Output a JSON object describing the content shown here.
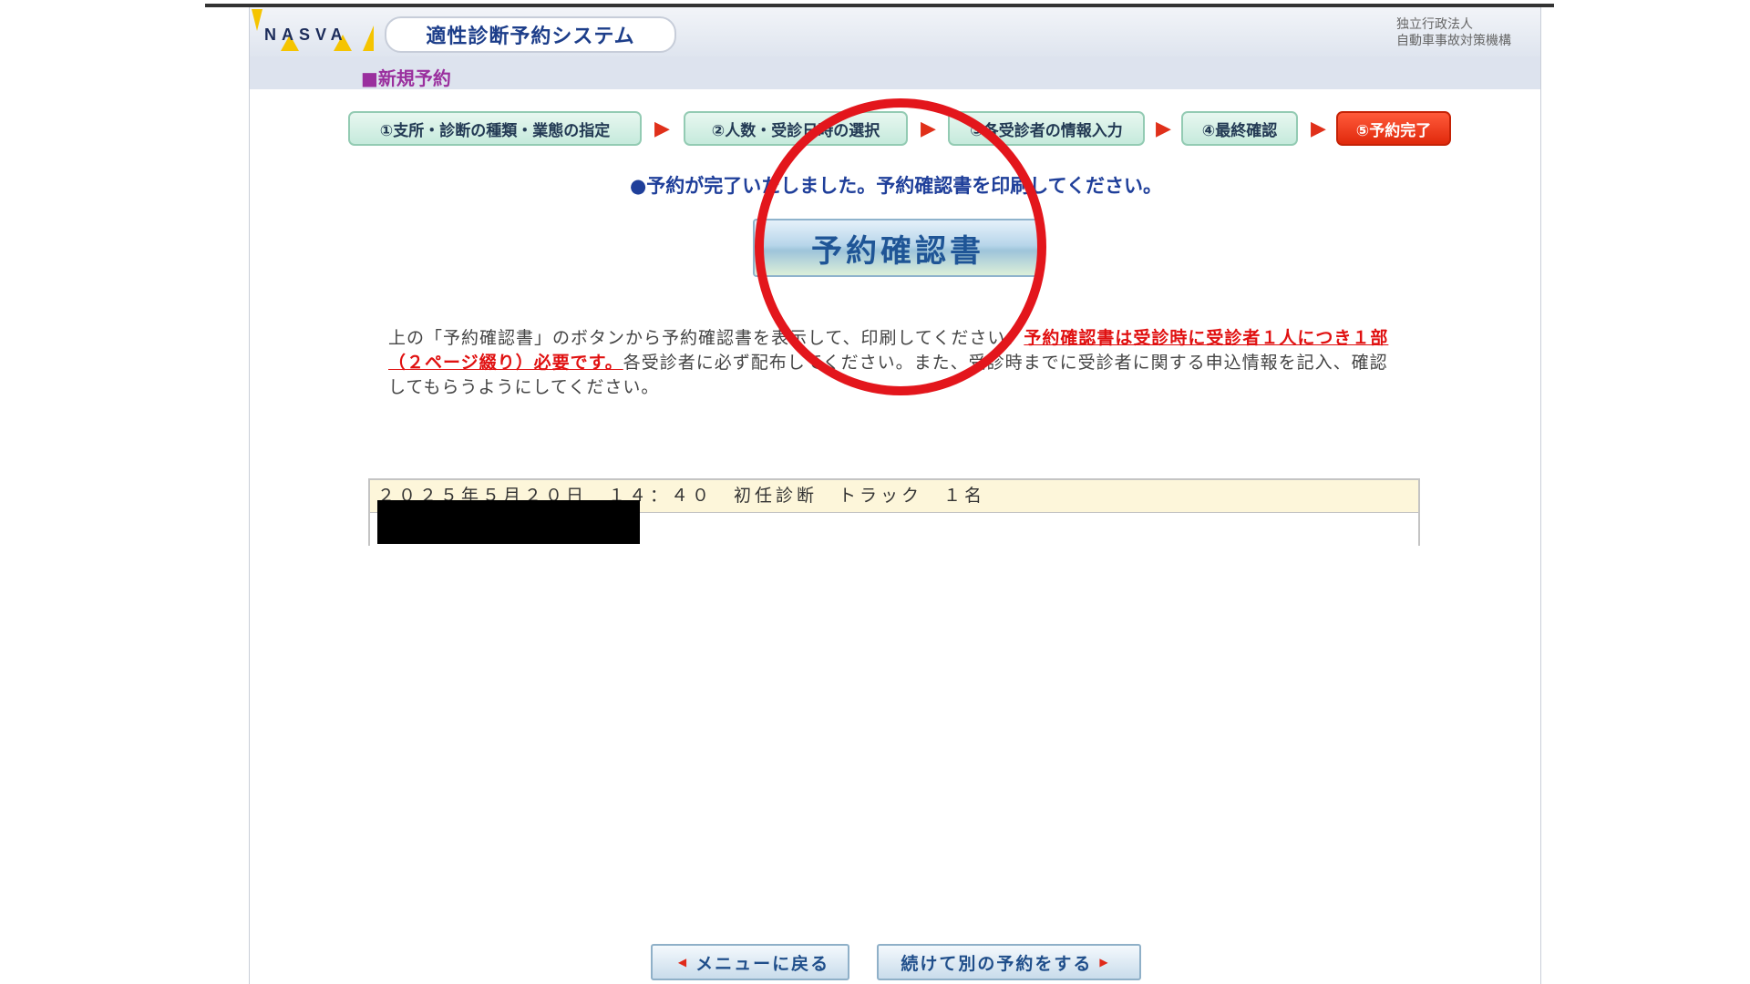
{
  "header": {
    "logo_text": "NASVA",
    "system_title": "適性診断予約システム",
    "org_line1": "独立行政法人",
    "org_line2": "自動車事故対策機構"
  },
  "section_title": "■新規予約",
  "steps": [
    {
      "label": "①支所・診断の種類・業態の指定",
      "active": false
    },
    {
      "label": "②人数・受診日時の選択",
      "active": false
    },
    {
      "label": "③各受診者の情報入力",
      "active": false
    },
    {
      "label": "④最終確認",
      "active": false
    },
    {
      "label": "⑤予約完了",
      "active": true
    }
  ],
  "step_arrow": "▶",
  "notice": "●予約が完了いたしました。予約確認書を印刷してください。",
  "confirm_button_label": "予約確認書",
  "instructions": {
    "part1": "上の「予約確認書」のボタンから予約確認書を表示して、印刷してください。",
    "warning": "予約確認書は受診時に受診者１人につき１部（２ページ綴り）必要です。",
    "part2": "各受診者に必ず配布してください。また、受診時までに受診者に関する申込情報を記入、確認してもらうようにしてください。"
  },
  "appointment": {
    "summary": "２０２５年５月２０日　１４：４０　初任診断　トラック　１名"
  },
  "nav": {
    "back_label": "メニューに戻る",
    "next_label": "続けて別の予約をする",
    "tri_left": "◀",
    "tri_right": "▶"
  },
  "colors": {
    "highlight_circle": "#e3161c",
    "active_step": "#e0290c",
    "warning_text": "#e01010",
    "notice_text": "#1f3f9a"
  }
}
